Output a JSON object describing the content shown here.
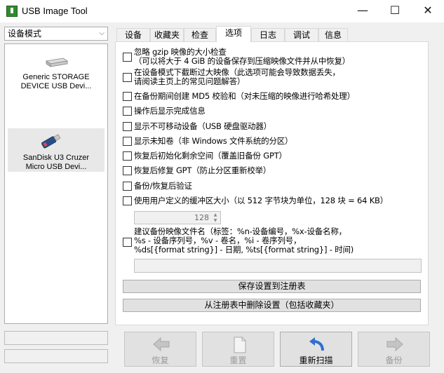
{
  "window": {
    "title": "USB Image Tool"
  },
  "sidebar": {
    "mode_select": "设备模式",
    "devices": [
      {
        "label_line1": "Generic STORAGE",
        "label_line2": "DEVICE USB Devi..."
      },
      {
        "label_line1": "SanDisk U3 Cruzer",
        "label_line2": "Micro USB Devi..."
      }
    ]
  },
  "tabs": [
    "设备",
    "收藏夹",
    "检查",
    "选项",
    "日志",
    "调试",
    "信息"
  ],
  "active_tab": "选项",
  "options": [
    {
      "line1": "忽略 gzip 映像的大小检查",
      "line2": "（可以将大于 4 GiB 的设备保存到压缩映像文件并从中恢复）",
      "checked": false
    },
    {
      "line1": "在设备模式下截断过大映像（此选项可能会导致数据丢失，",
      "line2": "请阅读主页上的常见问题解答）",
      "checked": false
    },
    {
      "line1": "在备份期间创建 MD5 校验和（对未压缩的映像进行哈希处理）",
      "checked": false
    },
    {
      "line1": "操作后显示完成信息",
      "checked": false
    },
    {
      "line1": "显示不可移动设备（USB 硬盘驱动器）",
      "checked": false
    },
    {
      "line1": "显示未知卷（非 Windows 文件系统的分区）",
      "checked": false
    },
    {
      "line1": "恢复后初始化剩余空间（覆盖旧备份 GPT）",
      "checked": false
    },
    {
      "line1": "恢复后修复 GPT（防止分区重新校举）",
      "checked": false
    },
    {
      "line1": "备份/恢复后验证",
      "checked": false
    },
    {
      "line1": "使用用户定义的缓冲区大小（以 512 字节块为单位，128 块 = 64 KB）",
      "checked": false
    }
  ],
  "buffer_size": {
    "value": "128"
  },
  "filename_option": {
    "line1": "建议备份映像文件名（标签：%n-设备编号，%x-设备名称，",
    "line2": "%s - 设备序列号，%v - 卷名，%i - 卷序列号，",
    "line3": "%ds[{format string}] - 日期, %ts[{format string}] - 时间)",
    "checked": false,
    "value": ""
  },
  "panel_buttons": {
    "save": "保存设置到注册表",
    "delete": "从注册表中删除设置（包括收藏夹）"
  },
  "bottom_buttons": {
    "restore": "恢复",
    "reset": "重置",
    "rescan": "重新扫描",
    "backup": "备份"
  }
}
